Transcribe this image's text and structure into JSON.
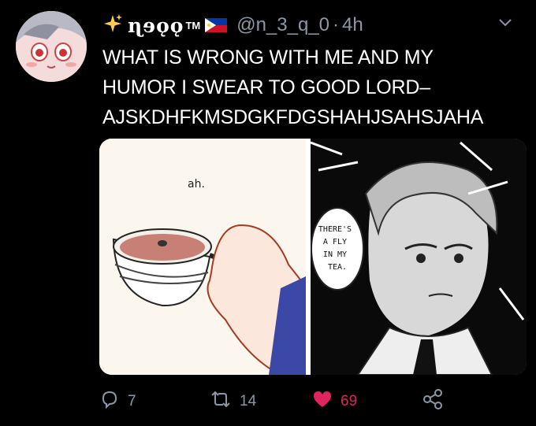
{
  "tweet": {
    "display_name": "ɳɘǫǫ",
    "tm": "TM",
    "handle": "@n_3_q_0",
    "separator": "·",
    "time": "4h",
    "text_lines": [
      "WHAT IS WRONG WITH ME AND MY",
      "HUMOR I SWEAR TO GOOD LORD–",
      "AJSKDHFKMSDGKFDGSHAHJSAHSJAHA"
    ]
  },
  "media": {
    "left_caption": "ah.",
    "speech_bubble": [
      "THERE'S",
      "A FLY",
      "IN MY",
      "TEA."
    ]
  },
  "actions": {
    "replies": "7",
    "retweets": "14",
    "likes": "69"
  },
  "colors": {
    "background": "#000000",
    "text": "#ffffff",
    "muted": "#8b98a5",
    "like": "#e0245e"
  },
  "icons": [
    "sparkles-icon",
    "philippines-flag-icon",
    "chevron-down-icon",
    "reply-icon",
    "retweet-icon",
    "heart-icon",
    "share-icon"
  ]
}
